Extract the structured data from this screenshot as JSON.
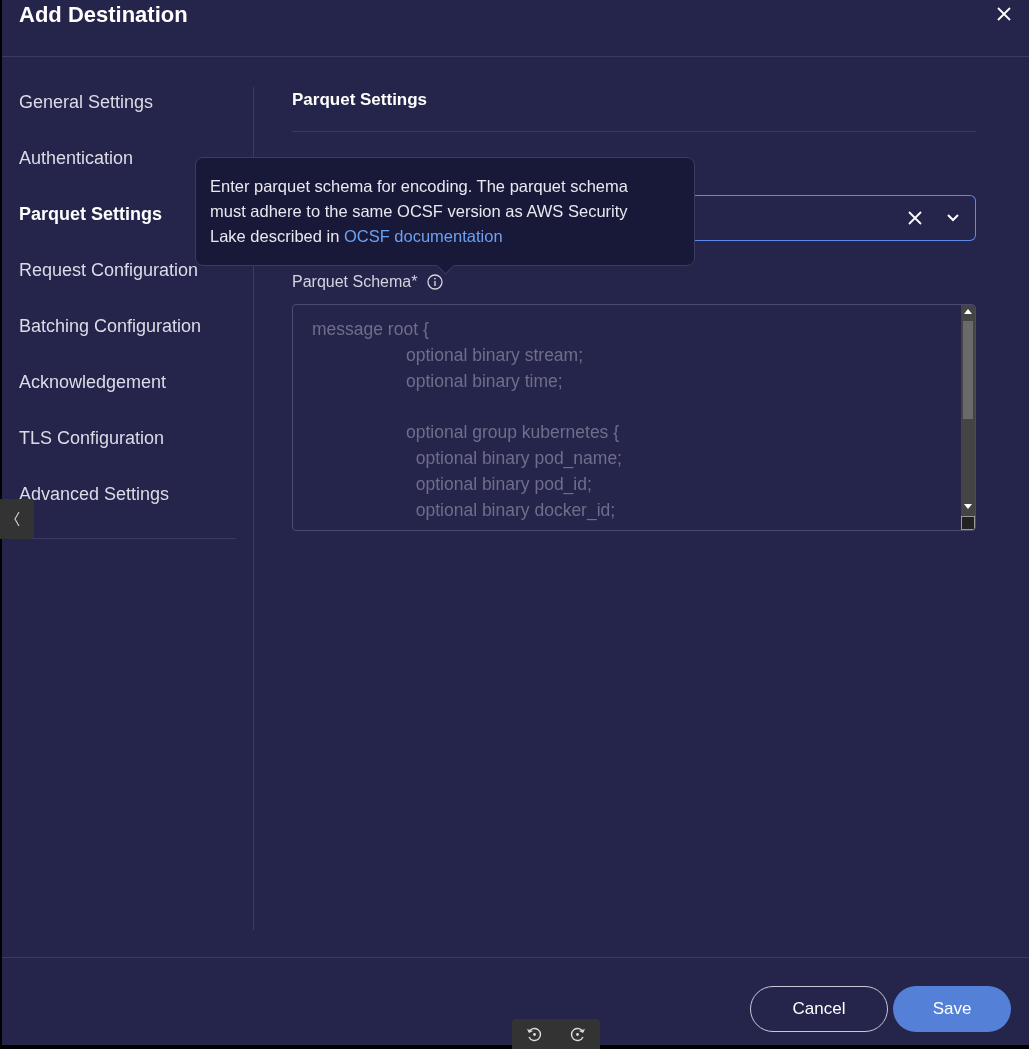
{
  "window": {
    "title": "Add Destination"
  },
  "sidebar": {
    "items": [
      {
        "label": "General Settings",
        "selected": false
      },
      {
        "label": "Authentication",
        "selected": false
      },
      {
        "label": "Parquet Settings",
        "selected": true
      },
      {
        "label": "Request Configuration",
        "selected": false
      },
      {
        "label": "Batching Configuration",
        "selected": false
      },
      {
        "label": "Acknowledgement",
        "selected": false
      },
      {
        "label": "TLS Configuration",
        "selected": false
      },
      {
        "label": "Advanced Settings",
        "selected": false
      }
    ]
  },
  "section": {
    "heading": "Parquet Settings",
    "tooltip": {
      "text": "Enter parquet schema for encoding. The parquet schema must adhere to the same OCSF version as AWS Security Lake described in ",
      "link": "OCSF documentation"
    },
    "schema": {
      "label": "Parquet Schema*",
      "placeholder": [
        "message root {",
        "\t\toptional binary stream;",
        "\t\toptional binary time;",
        "\n\t\toptional group kubernetes {",
        "\t\t  optional binary pod_name;",
        "\t\t  optional binary pod_id;",
        "\t\t  optional binary docker_id;"
      ]
    }
  },
  "buttons": [
    {
      "label": "Cancel",
      "kind": "secondary"
    },
    {
      "label": "Save",
      "kind": "primary"
    }
  ]
}
